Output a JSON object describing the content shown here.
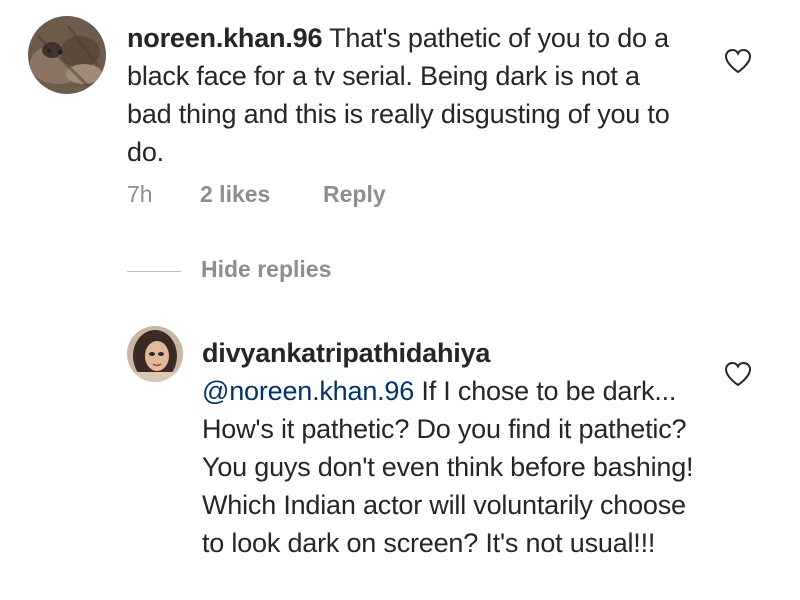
{
  "comment": {
    "username": "noreen.khan.96",
    "text": "That's pathetic of you to do a black face for a tv serial. Being dark is not a bad thing and this is really disgusting of you to do.",
    "time": "7h",
    "likes": "2 likes",
    "reply_label": "Reply",
    "like_icon": "heart-outline-icon"
  },
  "replies_toggle": {
    "label": "Hide replies"
  },
  "reply": {
    "username": "divyankatripathidahiya",
    "mention": "@noreen.khan.96",
    "text": "If I chose to be dark... How's it pathetic? Do you find it pathetic? You guys don't even think before bashing! Which Indian actor will voluntarily choose to look dark on screen? It's not usual!!!",
    "like_icon": "heart-outline-icon"
  },
  "colors": {
    "text": "#262626",
    "secondary": "#8e8e8e",
    "mention": "#003569"
  }
}
